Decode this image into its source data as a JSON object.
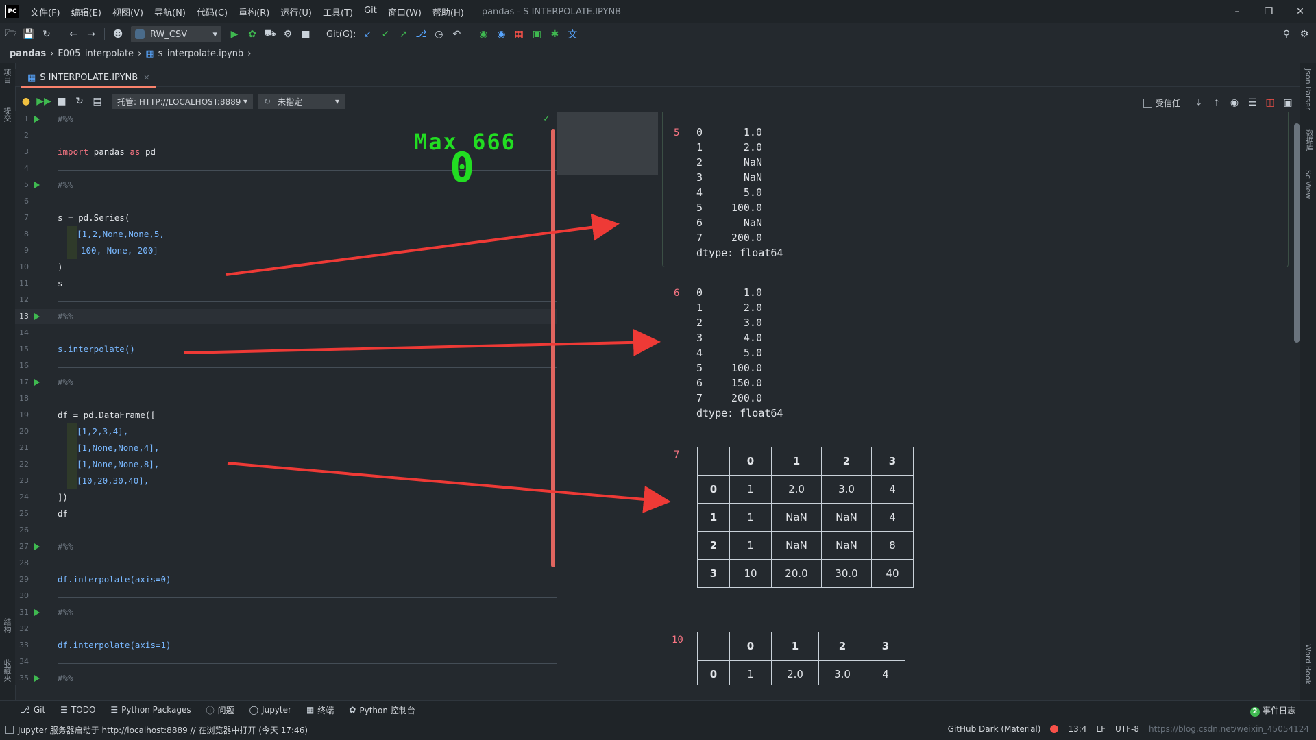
{
  "titlebar": {
    "logo": "PC",
    "menu": [
      "文件(F)",
      "编辑(E)",
      "视图(V)",
      "导航(N)",
      "代码(C)",
      "重构(R)",
      "运行(U)",
      "工具(T)",
      "Git",
      "窗口(W)",
      "帮助(H)"
    ],
    "title": "pandas - S INTERPOLATE.IPYNB"
  },
  "toolbar": {
    "run_config": "RW_CSV",
    "git_label": "Git(G):"
  },
  "breadcrumb": {
    "project": "pandas",
    "folder": "E005_interpolate",
    "file": "s_interpolate.ipynb"
  },
  "left_strip": {
    "project_label": "项目",
    "commit_label": "提交",
    "structure_label": "结构",
    "favorites_label": "收藏夹"
  },
  "right_strip": {
    "json_label": "Json Parser",
    "db_label": "数据库",
    "sciview_label": "SciView",
    "wordbook_label": "Word Book"
  },
  "tab": {
    "label": "S INTERPOLATE.IPYNB"
  },
  "notebook_toolbar": {
    "server": "托管: HTTP://LOCALHOST:8889",
    "kernel": "未指定",
    "trusted": "受信任"
  },
  "editor": {
    "line_numbers": [
      "1",
      "2",
      "3",
      "4",
      "5",
      "6",
      "7",
      "8",
      "9",
      "10",
      "11",
      "12",
      "13",
      "14",
      "15",
      "16",
      "17",
      "18",
      "19",
      "20",
      "21",
      "22",
      "23",
      "24",
      "25",
      "26",
      "27",
      "28",
      "29",
      "30",
      "31",
      "32",
      "33",
      "34",
      "35"
    ],
    "current_line": "13",
    "cell_marker": "#%%",
    "import_kw": "import",
    "import_mod": "pandas",
    "as_kw": "as",
    "import_alias": "pd",
    "series_call": "s = pd.Series(",
    "series_list_1": "[1,2,None,None,5,",
    "series_list_2": "100, None, 200]",
    "close_paren": ")",
    "s_var": "s",
    "interp_call": "s.interpolate()",
    "df_call": "df = pd.DataFrame([",
    "df_row_1": "[1,2,3,4],",
    "df_row_2": "[1,None,None,4],",
    "df_row_3": "[1,None,None,8],",
    "df_row_4": "[10,20,30,40],",
    "df_close": "])",
    "df_var": "df",
    "interp_axis0": "df.interpolate(axis=0)",
    "interp_axis1": "df.interpolate(axis=1)"
  },
  "overlay": {
    "max_label": "Max 666",
    "counter": "0",
    "arrow_color": "#ee3a36",
    "counter_color": "#22dd22"
  },
  "output": {
    "cell5": {
      "number": "5",
      "rows": [
        [
          "0",
          "1.0"
        ],
        [
          "1",
          "2.0"
        ],
        [
          "2",
          "NaN"
        ],
        [
          "3",
          "NaN"
        ],
        [
          "4",
          "5.0"
        ],
        [
          "5",
          "100.0"
        ],
        [
          "6",
          "NaN"
        ],
        [
          "7",
          "200.0"
        ]
      ],
      "dtype": "dtype: float64"
    },
    "cell6": {
      "number": "6",
      "rows": [
        [
          "0",
          "1.0"
        ],
        [
          "1",
          "2.0"
        ],
        [
          "2",
          "3.0"
        ],
        [
          "3",
          "4.0"
        ],
        [
          "4",
          "5.0"
        ],
        [
          "5",
          "100.0"
        ],
        [
          "6",
          "150.0"
        ],
        [
          "7",
          "200.0"
        ]
      ],
      "dtype": "dtype: float64"
    },
    "cell7": {
      "number": "7",
      "columns": [
        "",
        "0",
        "1",
        "2",
        "3"
      ],
      "rows": [
        [
          "0",
          "1",
          "2.0",
          "3.0",
          "4"
        ],
        [
          "1",
          "1",
          "NaN",
          "NaN",
          "4"
        ],
        [
          "2",
          "1",
          "NaN",
          "NaN",
          "8"
        ],
        [
          "3",
          "10",
          "20.0",
          "30.0",
          "40"
        ]
      ]
    },
    "cell10": {
      "number": "10",
      "columns": [
        "",
        "0",
        "1",
        "2",
        "3"
      ],
      "rows": [
        [
          "0",
          "1",
          "2.0",
          "3.0",
          "4"
        ]
      ]
    }
  },
  "bottom_tabs": [
    "Git",
    "TODO",
    "Python Packages",
    "问题",
    "Jupyter",
    "终端",
    "Python 控制台"
  ],
  "event_log": {
    "count": "2",
    "label": "事件日志"
  },
  "statusbar": {
    "message": "Jupyter 服务器启动于 http://localhost:8889 // 在浏览器中打开 (今天 17:46)",
    "theme": "GitHub Dark (Material)",
    "position": "13:4",
    "line_sep": "LF",
    "encoding": "UTF-8",
    "url_text": "https://blog.csdn.net/weixin_45054124"
  }
}
